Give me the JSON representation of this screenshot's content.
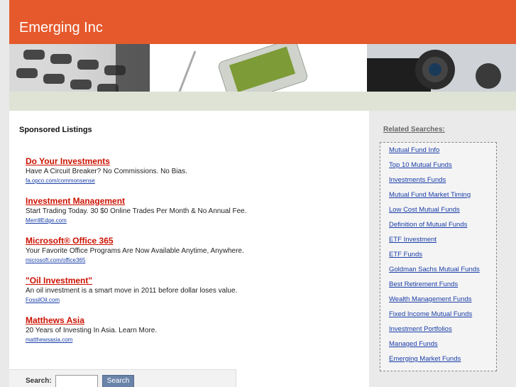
{
  "site": {
    "title": "Emerging Inc"
  },
  "main": {
    "sponsored_heading": "Sponsored Listings",
    "listings": [
      {
        "title": "Do Your Investments",
        "desc": "Have A Circuit Breaker? No Commissions. No Bias.",
        "url": "fa.opco.com/commonsense"
      },
      {
        "title": "Investment Management",
        "desc": "Start Trading Today. 30 $0 Online Trades Per Month & No Annual Fee.",
        "url": "MerrillEdge.com"
      },
      {
        "title": "Microsoft® Office 365",
        "desc": "Your Favorite Office Programs Are Now Available Anytime, Anywhere.",
        "url": "microsoft.com/office365"
      },
      {
        "title": "\"Oil Investment\"",
        "desc": "An oil investment is a smart move in 2011 before dollar loses value.",
        "url": "FossilOil.com"
      },
      {
        "title": "Matthews Asia",
        "desc": "20 Years of Investing In Asia. Learn More.",
        "url": "matthewsasia.com"
      }
    ]
  },
  "search": {
    "label": "Search:",
    "value": "",
    "button": "Search"
  },
  "sidebar": {
    "heading": "Related Searches:",
    "links": [
      "Mutual Fund Info",
      "Top 10 Mutual Funds",
      "Investments Funds",
      "Mutual Fund Market Timing",
      "Low Cost Mutual Funds",
      "Definition of Mutual Funds",
      "ETF Investment",
      "ETF Funds",
      "Goldman Sachs Mutual Funds",
      "Best Retirement Funds",
      "Wealth Management Funds",
      "Fixed Income Mutual Funds",
      "Investment Portfolios",
      "Managed Funds",
      "Emerging Market Funds"
    ]
  },
  "colors": {
    "header": "#e5592c",
    "listing_title": "#cc1100",
    "link": "#1a3ea8"
  }
}
